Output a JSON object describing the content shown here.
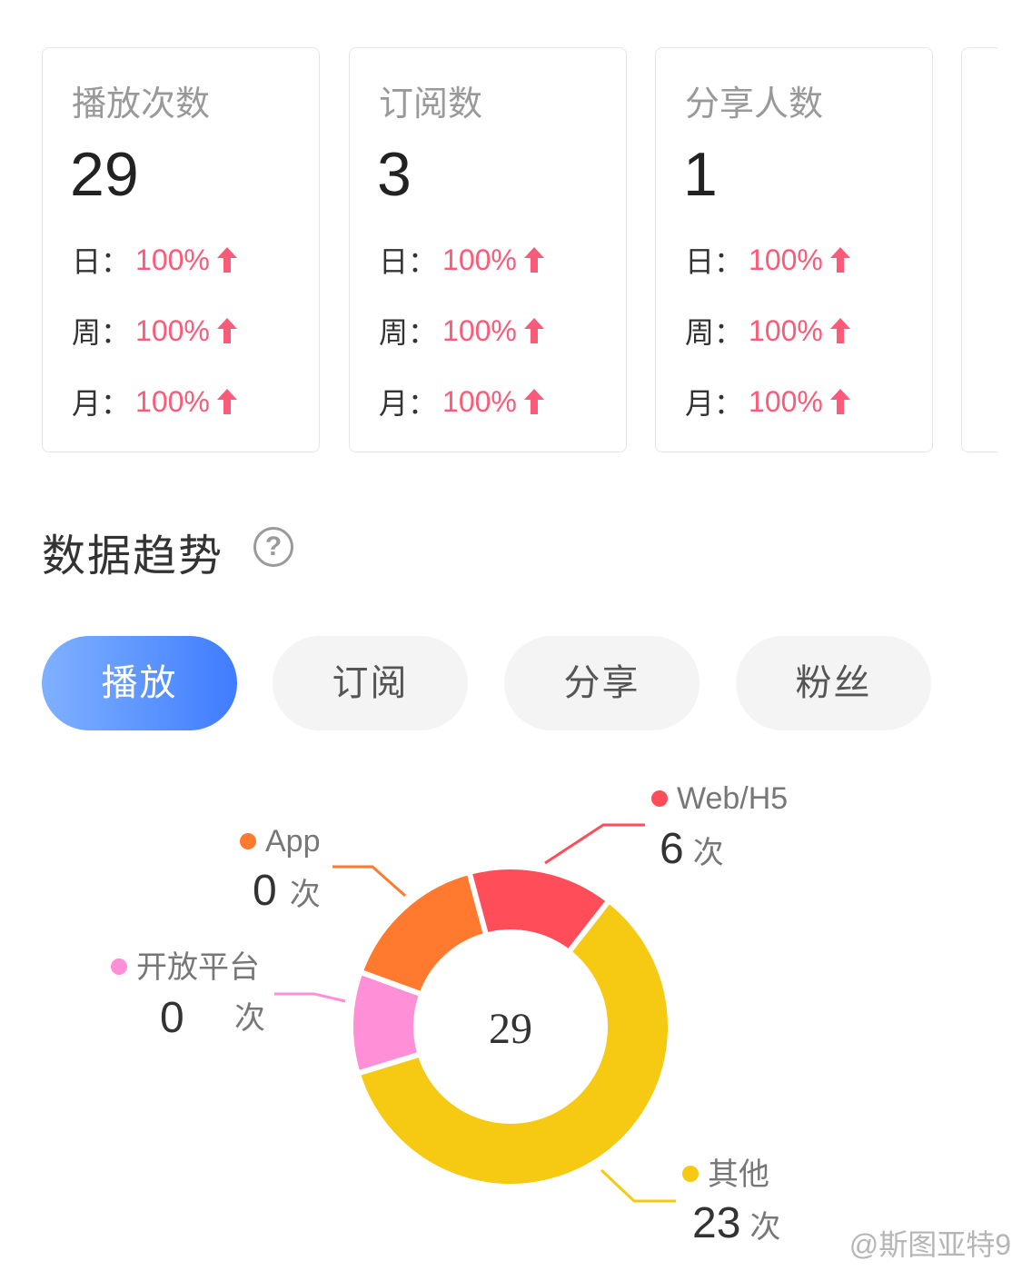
{
  "cards": [
    {
      "title": "播放次数",
      "value": "29",
      "rates": [
        {
          "label": "日：",
          "pct": "100%"
        },
        {
          "label": "周：",
          "pct": "100%"
        },
        {
          "label": "月：",
          "pct": "100%"
        }
      ]
    },
    {
      "title": "订阅数",
      "value": "3",
      "rates": [
        {
          "label": "日：",
          "pct": "100%"
        },
        {
          "label": "周：",
          "pct": "100%"
        },
        {
          "label": "月：",
          "pct": "100%"
        }
      ]
    },
    {
      "title": "分享人数",
      "value": "1",
      "rates": [
        {
          "label": "日：",
          "pct": "100%"
        },
        {
          "label": "周：",
          "pct": "100%"
        },
        {
          "label": "月：",
          "pct": "100%"
        }
      ]
    }
  ],
  "section": {
    "title": "数据趋势",
    "help_icon": "help-icon"
  },
  "tabs": [
    {
      "label": "播放",
      "active": true
    },
    {
      "label": "订阅",
      "active": false
    },
    {
      "label": "分享",
      "active": false
    },
    {
      "label": "粉丝",
      "active": false
    }
  ],
  "chart_data": {
    "type": "pie",
    "center_label": "29",
    "unit": "次",
    "slices": [
      {
        "name": "Web/H5",
        "value": 6,
        "color": "#ff4d5a"
      },
      {
        "name": "其他",
        "value": 23,
        "color": "#f6c913"
      },
      {
        "name": "开放平台",
        "value": 0,
        "color": "#ff8fd6"
      },
      {
        "name": "App",
        "value": 0,
        "color": "#ff7a2e"
      }
    ]
  },
  "watermark": "@斯图亚特9",
  "colors": {
    "accent": "#3f7cff",
    "up": "#fb5a78"
  }
}
